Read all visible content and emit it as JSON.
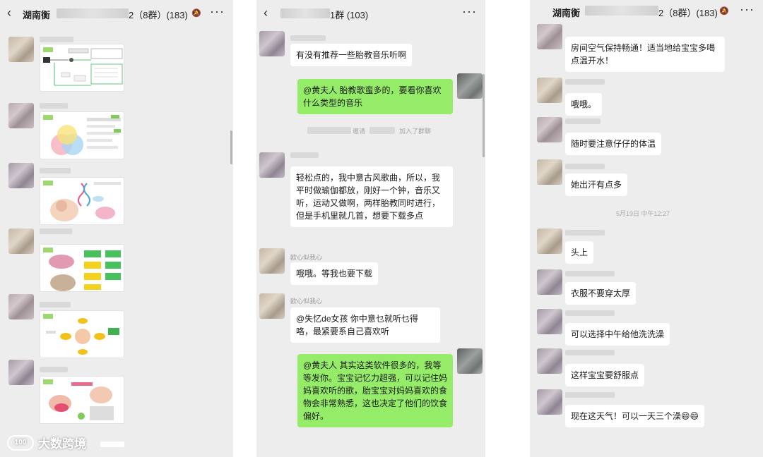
{
  "panel1": {
    "title_prefix": "湖南衡",
    "title_suffix": "2（8群）(183)",
    "back_icon": "‹",
    "more_icon": "···",
    "mute_icon": "🔕"
  },
  "panel2": {
    "title_suffix": "1群 (103)",
    "back_icon": "‹",
    "more_icon": "···",
    "messages": [
      {
        "side": "left",
        "text": "有没有推荐一些胎教音乐听啊"
      },
      {
        "side": "right",
        "text": "@黄夫人 胎教歌蛮多的，要看你喜欢什么类型的音乐"
      },
      {
        "type": "system",
        "text": "加入了群聊",
        "text_mid": "邀请"
      },
      {
        "side": "left",
        "text": "轻松点的，我中意古风歌曲，所以，我平时做瑜伽都放，刚好一个钟，音乐又听，运动又做啊，两样胎教同时进行，但是手机里就几首，想要下载多点"
      },
      {
        "side": "left",
        "sender": "欧心似我心",
        "text": "哦哦。等我也要下载"
      },
      {
        "side": "left",
        "sender": "欧心似我心",
        "text": "@失忆de女孩 你中意乜就听乜得咯，最紧要系自己喜欢听"
      },
      {
        "side": "right",
        "text": "@黄夫人 其实这类软件很多的，我等等发你。宝宝记忆力超强，可以记住妈妈喜欢听的歌，胎宝宝对妈妈喜欢的食物会非常熟悉，这也决定了他们的饮食偏好。"
      }
    ]
  },
  "panel3": {
    "title_prefix": "湖南衡",
    "title_suffix": "2（8群）(183)",
    "more_icon": "···",
    "mute_icon": "🔕",
    "time": "5月19日 中午12:27",
    "messages": [
      {
        "text": "房间空气保持畅通！适当地给宝宝多喝点温开水！"
      },
      {
        "text": "哦哦。"
      },
      {
        "text": "随时要注意仔仔的体温"
      },
      {
        "text": "她出汗有点多"
      },
      {
        "text": "头上"
      },
      {
        "text": "衣服不要穿太厚"
      },
      {
        "text": "可以选择中午给他洗洗澡"
      },
      {
        "text": "这样宝宝要舒服点"
      },
      {
        "text": "现在这天气！可以一天三个澡😄😄"
      }
    ]
  },
  "watermark": {
    "logo_text": "100",
    "text": "大数跨境"
  },
  "colors": {
    "chat_bg": "#ededed",
    "green_bubble": "#95ec69",
    "white_bubble": "#ffffff"
  }
}
